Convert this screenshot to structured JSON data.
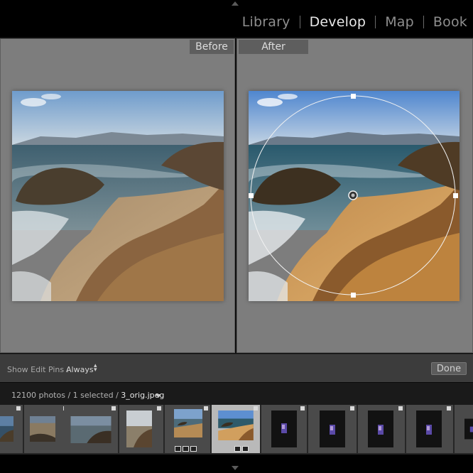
{
  "modules": {
    "items": [
      {
        "label": "Library",
        "active": false
      },
      {
        "label": "Develop",
        "active": true
      },
      {
        "label": "Map",
        "active": false
      },
      {
        "label": "Book",
        "active": false
      }
    ]
  },
  "compare": {
    "before_label": "Before",
    "after_label": "After"
  },
  "toolbar": {
    "show_pins_label": "Show Edit Pins :",
    "show_pins_value": "Always",
    "done_label": "Done"
  },
  "filmstrip": {
    "count_text": "12100 photos / 1 selected / ",
    "file_name": "3_orig.jpeg",
    "selected_index": 4
  },
  "colors": {
    "pane_bg": "#7d7d7d",
    "selected_cell": "#b9b9b9",
    "active_module": "#e8e8e8"
  }
}
